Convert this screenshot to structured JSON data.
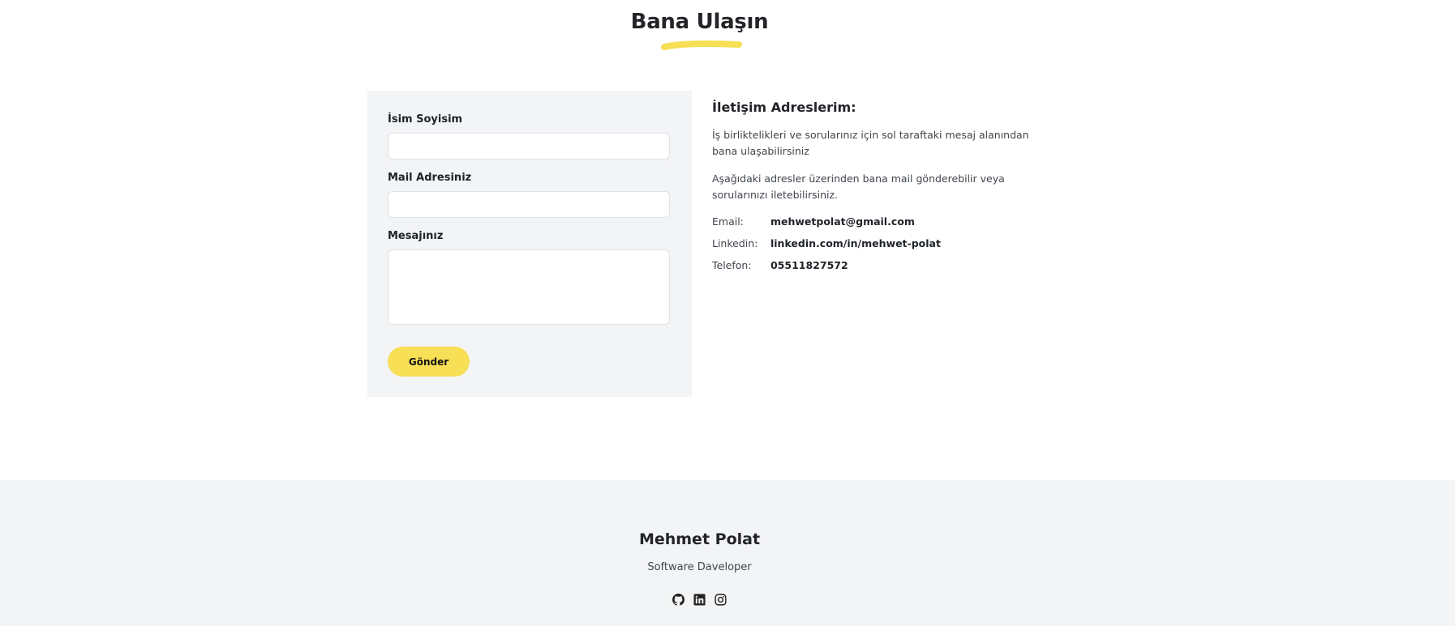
{
  "heading": {
    "title": "Bana Ulaşın",
    "underline_color": "#f7df56"
  },
  "form": {
    "name_label": "İsim Soyisim",
    "name_value": "",
    "email_label": "Mail Adresiniz",
    "email_value": "",
    "message_label": "Mesajınız",
    "message_value": "",
    "submit_label": "Gönder",
    "panel_color": "#f3f4f6",
    "button_color": "#f7df56"
  },
  "contact": {
    "title": "İletişim Adreslerim:",
    "paragraph1": "İş birliktelikleri ve sorularınız için sol taraftaki mesaj alanından bana ulaşabilirsiniz",
    "paragraph2": "Aşağıdaki adresler üzerinden bana mail gönderebilir veya sorularınızı iletebilirsiniz.",
    "rows": [
      {
        "key": "Email:",
        "value": "mehwetpolat@gmail.com"
      },
      {
        "key": "Linkedin:",
        "value": "linkedin.com/in/mehwet-polat"
      },
      {
        "key": "Telefon:",
        "value": "05511827572"
      }
    ]
  },
  "footer": {
    "name": "Mehmet Polat",
    "role": "Software Daveloper",
    "icons": [
      "github-icon",
      "linkedin-icon",
      "instagram-icon"
    ]
  }
}
